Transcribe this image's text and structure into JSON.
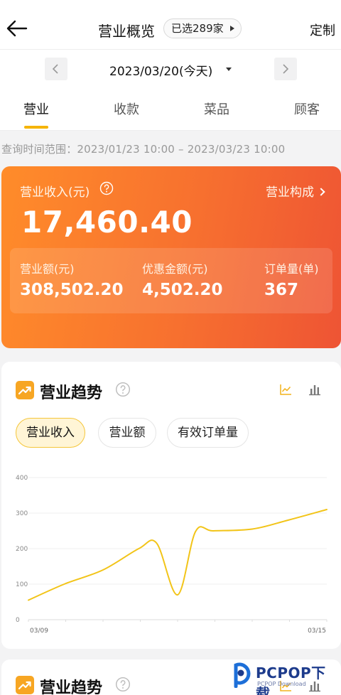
{
  "header": {
    "title": "营业概览",
    "store_chip": "已选289家",
    "custom_label": "定制"
  },
  "date_bar": {
    "date": "2023/03/20(今天)"
  },
  "tabs": [
    {
      "label": "营业",
      "active": true
    },
    {
      "label": "收款",
      "active": false
    },
    {
      "label": "菜品",
      "active": false
    },
    {
      "label": "顾客",
      "active": false
    }
  ],
  "query_range": "查询时间范围：2023/01/23 10:00 – 2023/03/23 10:00",
  "summary": {
    "label": "营业收入(元)",
    "value": "17,460.40",
    "composition_link": "营业构成",
    "metrics": [
      {
        "label": "营业额(元)",
        "value": "308,502.20"
      },
      {
        "label": "优惠金额(元)",
        "value": "4,502.20"
      },
      {
        "label": "订单量(单)",
        "value": "367"
      }
    ]
  },
  "trend": {
    "title": "营业趋势",
    "pills": [
      {
        "label": "营业收入",
        "active": true
      },
      {
        "label": "营业额",
        "active": false
      },
      {
        "label": "有效订单量",
        "active": false
      }
    ]
  },
  "trend_2": {
    "title": "营业趋势"
  },
  "watermark": {
    "text": "PCPOP下载",
    "sub": "PCPOP Download"
  },
  "colors": {
    "accent": "#f5b400",
    "line": "#f2c418",
    "card_gradient_start": "#ff8c2a",
    "card_gradient_end": "#ee5434"
  },
  "chart_data": {
    "type": "line",
    "x_tick_labels": [
      "03/09",
      "03/15"
    ],
    "x": [
      0,
      0.12,
      0.25,
      0.37,
      0.43,
      0.5,
      0.56,
      0.62,
      0.75,
      0.87,
      1.0
    ],
    "values": [
      55,
      100,
      140,
      200,
      215,
      70,
      248,
      250,
      255,
      280,
      310
    ],
    "ylim": [
      0,
      400
    ],
    "yticks": [
      0,
      100,
      200,
      300,
      400
    ],
    "grid": true
  }
}
